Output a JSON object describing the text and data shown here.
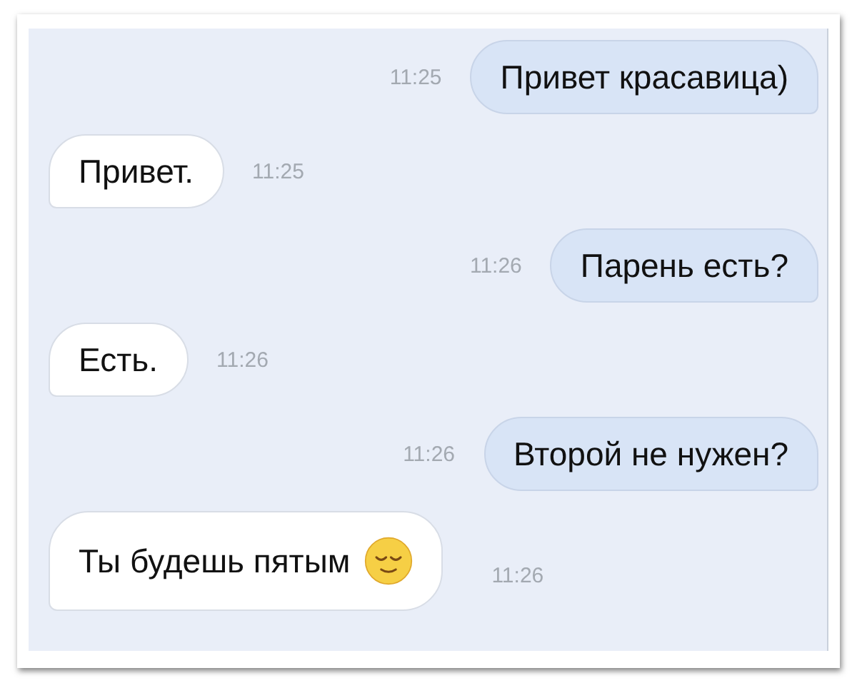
{
  "messages": [
    {
      "kind": "sent",
      "text": "Привет красавица)",
      "time": "11:25"
    },
    {
      "kind": "received",
      "text": "Привет.",
      "time": "11:25"
    },
    {
      "kind": "sent",
      "text": "Парень есть?",
      "time": "11:26"
    },
    {
      "kind": "received",
      "text": "Есть.",
      "time": "11:26"
    },
    {
      "kind": "sent",
      "text": "Второй не нужен?",
      "time": "11:26"
    },
    {
      "kind": "received",
      "text": "Ты будешь пятым",
      "time": "11:26",
      "emoji": true
    }
  ]
}
